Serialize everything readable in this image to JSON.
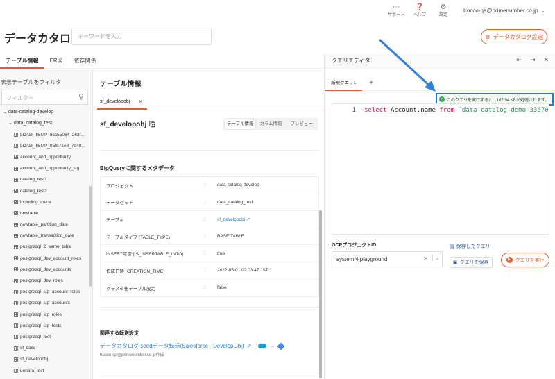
{
  "topbar": {
    "support_label": "サポート",
    "help_label": "ヘルプ",
    "settings_label": "設定",
    "user_email": "trocco-qa@primenumber.co.jp"
  },
  "header": {
    "title": "データカタログ",
    "search_placeholder": "キーワードを入力",
    "catalog_settings_label": "データカタログ設定"
  },
  "left_tabs": [
    "テーブル情報",
    "ER図",
    "依存関係"
  ],
  "sidebar": {
    "title": "表示テーブルをフィルタ",
    "filter_placeholder": "フィルター",
    "project": "data-catalog-develop",
    "dataset": "data_catalog_test",
    "tables": [
      "LOAD_TEMP_8cc55064_263f...",
      "LOAD_TEMP_95f871e8_7a49...",
      "account_and_opportunity",
      "account_and_opportunity_stg",
      "catalog_test1",
      "catalog_test2",
      "including space",
      "newtable",
      "newtable_partition_date",
      "newtable_transaction_date",
      "postgresql_2_same_table",
      "postgresql_dev_account_roles",
      "postgresql_dev_accounts",
      "postgresql_dev_roles",
      "postgresql_stg_account_roles",
      "postgresql_stg_accounts",
      "postgresql_stg_roles",
      "postgresql_stg_tests",
      "postgresql_test",
      "sf_case",
      "sf_developobj",
      "uehara_test"
    ]
  },
  "middle": {
    "title": "テーブル情報",
    "open_tab": "sf_developobj",
    "table_name": "sf_developobj",
    "segments": [
      "テーブル情報",
      "カラム情報",
      "プレビュー"
    ],
    "meta_title": "BigQueryに関するメタデータ",
    "meta_rows": [
      {
        "key": "プロジェクト",
        "value": "data-catalog-develop"
      },
      {
        "key": "データセット",
        "value": "data_catalog_test"
      },
      {
        "key": "テーブル",
        "value": "sf_developobj"
      },
      {
        "key": "テーブルタイプ (TABLE_TYPE)",
        "value": "BASE TABLE"
      },
      {
        "key": "INSERT可否 (IS_INSERTABLE_INTO)",
        "value": "true"
      },
      {
        "key": "作成日時 (CREATION_TIME)",
        "value": "2022-05-01 02:03:47 JST"
      },
      {
        "key": "クラスタ化テーブル設定",
        "value": "false"
      }
    ],
    "related_title": "関連する転送設定",
    "related_link": "データカタログ seedデータ転送(Salesforce - DevelopObj)",
    "related_sub": "trocco-qa@primenumber.co.jp作成"
  },
  "query_editor": {
    "title": "クエリエディタ",
    "tab_label": "新規クエリ1",
    "notice": "このクエリを実行すると、107.94 KBが処理されます。",
    "code": {
      "line_no": "1",
      "kw_select": "select",
      "column": "Account.name",
      "kw_from": "from",
      "table_str": "`data-catalog-demo-335706.sal"
    },
    "gcp_label": "GCPプロジェクトID",
    "gcp_value": "systemN-playground",
    "saved_queries_label": "保存したクエリ",
    "save_query_label": "クエリを保存",
    "run_label": "クエリを実行"
  },
  "colors": {
    "accent": "#e85a2a",
    "link": "#2a7bd1",
    "notice_border": "#1a7be0",
    "success": "#3ba55d"
  }
}
